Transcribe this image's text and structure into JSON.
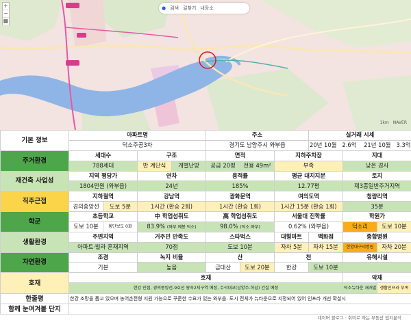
{
  "map": {
    "search_tabs": [
      "검색",
      "길찾기",
      "내장소"
    ],
    "zoom_in": "+",
    "zoom_out": "−",
    "scale_left": "1km",
    "scale_right": "NAVER"
  },
  "table": {
    "basic": {
      "category": "기본 정보",
      "h_apt": "아파트명",
      "h_addr": "주소",
      "h_trade": "실거래 시세",
      "apt": "덕소주공3차",
      "addr": "경기도 남양주시 와부읍",
      "t1_date": "20년 10월",
      "t1_price": "2.6억",
      "t2_date": "21년 10월",
      "t2_price": "3.3억"
    },
    "living": {
      "category": "주거환경",
      "h1": "세대수",
      "h2": "구조",
      "h3": "면적",
      "h4": "지하주차장",
      "h5": "지대",
      "v1": "788세대",
      "v2a": "반 계단식",
      "v2b": "개별난방",
      "v3a": "공급 20평",
      "v3b": "전용 49m²",
      "v4": "부족",
      "v5": "낮은 경사"
    },
    "rebuild": {
      "category": "재건축 사업성",
      "h1": "지역 평당가",
      "h2": "연차",
      "h3": "용적률",
      "h4": "평균 대지지분",
      "h5": "토지",
      "v1": "1804만원 (와부읍)",
      "v2": "24년",
      "v3": "185%",
      "v4": "12.77평",
      "v5": "제3종일반주거지역"
    },
    "commute": {
      "category": "직주근접",
      "h1": "지하철역",
      "h2": "강남역",
      "h3": "광화문역",
      "h4": "여의도역",
      "h5": "청량리역",
      "v1a": "경의중앙선",
      "v1b": "도보 5분",
      "v2": "1시간 (환승 2회)",
      "v3": "1시간 (환승 1회)",
      "v4": "1시간 15분 (환승 1회)",
      "v5": "35분"
    },
    "school": {
      "category": "학군",
      "h1": "초등학교",
      "h2": "中 학업성취도",
      "h3": "高 학업성취도",
      "h4": "서울대 진학률",
      "h5": "학원가",
      "v1a": "도보 10분",
      "v1b": "횡단보도 0회",
      "v2a": "83.9%",
      "v2b": "(와부.예봉.덕소)",
      "v3a": "98.0%",
      "v3b": "(덕소.와부)",
      "v4": "0.62% (와부읍)",
      "v5a": "덕소리",
      "v5b": "도보 10분"
    },
    "life": {
      "category": "생활환경",
      "h1": "주변지역",
      "h2": "거주민 만족도",
      "h3": "스타벅스",
      "h4a": "대형마트",
      "h4b": "백화점",
      "h5": "종합병원",
      "v1": "아파트·빌라 혼재지역",
      "v2": "70점",
      "v3": "도보 10분",
      "v4a": "자차 5분",
      "v4b": "자차 15분",
      "v5a": "한양대구리병원",
      "v5b": "자차 20분"
    },
    "nature": {
      "category": "자연환경",
      "h1": "조경",
      "h2": "녹지 비율",
      "h3": "산",
      "h4": "천",
      "h5": "유해시설",
      "v1": "기본",
      "v2": "높음",
      "v3a": "금대산",
      "v3b": "도보 20분",
      "v4a": "한강",
      "v4b": "도보 10분",
      "v5": ""
    },
    "positive": {
      "category": "호재",
      "h1": "호재",
      "h2": "악재",
      "v1": "한강 인접, 경의중앙선-9호선 왕숙2지구역 예정, 수석대교(남양주-하남) 건설 예정",
      "v2a": "덕소뉴타운 재개발 진행중",
      "v2b": "생활인프라 부족"
    },
    "review": {
      "category": "한줄평",
      "v1": "한강 조망을 품고 있으며 농어촌전형 지원 가능으로 꾸준한 수요가 있는 와부읍. 도시 전체가 뉴타운으로 지정되어 있어 인프라 개선 확실시"
    },
    "compare": {
      "category": "함께 눈여겨볼 단지",
      "v1": ""
    }
  },
  "footer": "네이버 블로그 : 취미로 하는 부동산 입지분석",
  "colors": {
    "category_green": "#4ea64a",
    "light_green": "#c8e4b6",
    "yellow": "#fbd44a",
    "orange": "#fbab18"
  }
}
